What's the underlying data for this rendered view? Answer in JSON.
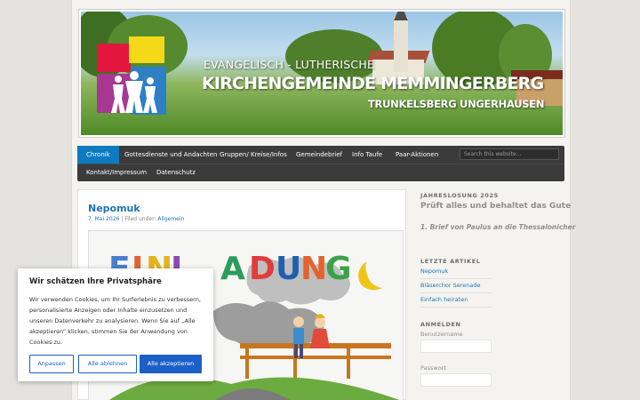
{
  "header": {
    "line1": "EVANGELISCH - LUTHERISCHE",
    "line2": "KIRCHENGEMEINDE MEMMINGERBERG",
    "line3": "TRUNKELSBERG UNGERHAUSEN"
  },
  "nav": {
    "items": [
      {
        "label": "Chronik",
        "active": true
      },
      {
        "label": "Gottesdienste und Andachten"
      },
      {
        "label": "Gruppen/ Kreise/Infos"
      },
      {
        "label": "Gemeindebrief"
      },
      {
        "label": "Info Taufe"
      },
      {
        "label": "Paar-Aktionen"
      },
      {
        "label": "Kontakt/Impressum"
      },
      {
        "label": "Datenschutz"
      }
    ],
    "search_placeholder": "Search this website..."
  },
  "post": {
    "title": "Nepomuk",
    "date": "7. Mai 2026",
    "separator": "|",
    "filed_label": "Filed under:",
    "category": "Allgemein",
    "image_text": "EINLADUNG"
  },
  "sidebar": {
    "jahreslosung": {
      "title": "JAHRESLOSUNG 2025",
      "verse": "Prüft alles und behaltet das Gute",
      "reference": "1. Brief von Paulus an die Thessalonicher"
    },
    "latest": {
      "title": "LETZTE ARTIKEL",
      "items": [
        "Nepomuk",
        "Bläserchor Serenade",
        "Einfach heiraten"
      ]
    },
    "login": {
      "title": "ANMELDEN",
      "username_label": "Benutzername",
      "password_label": "Passwort"
    }
  },
  "cookie": {
    "title": "Wir schätzen Ihre Privatsphäre",
    "text": "Wir verwenden Cookies, um Ihr Surferlebnis zu verbessern, personalisierte Anzeigen oder Inhalte einzusetzen und unseren Datenverkehr zu analysieren. Wenn Sie auf „Alle akzeptieren“ klicken, stimmen Sie der Anwendung von Cookies zu.",
    "btn_customize": "Anpassen",
    "btn_reject": "Alle ablehnen",
    "btn_accept": "Alle akzeptieren"
  },
  "colors": {
    "accent": "#1e74b4",
    "nav_bg": "#3b3b3b",
    "nav_active": "#0f7ac0",
    "button_blue": "#1d5fc8"
  }
}
